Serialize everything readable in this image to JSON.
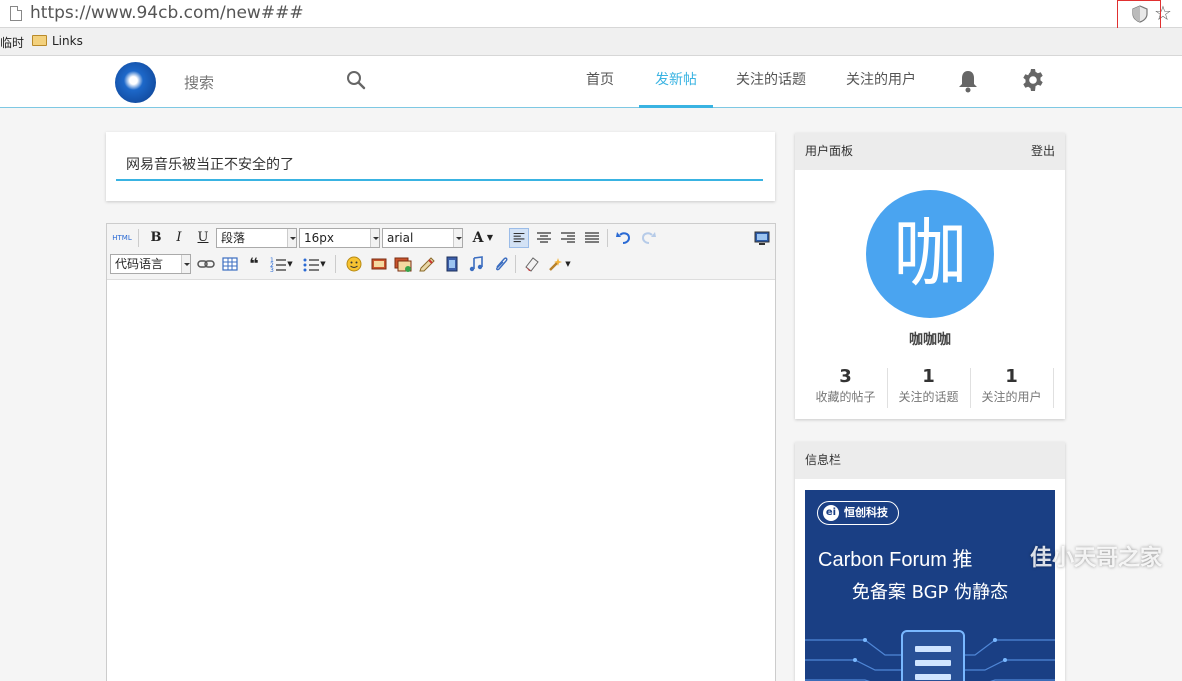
{
  "browser": {
    "url": "https://www.94cb.com/new###",
    "bookmarks": [
      "临时",
      "Links"
    ]
  },
  "nav": {
    "search_placeholder": "搜索",
    "items": [
      "首页",
      "发新帖",
      "关注的话题",
      "关注的用户"
    ],
    "active_item": "发新帖"
  },
  "composer": {
    "title_value": "网易音乐被当正不安全的了",
    "toolbar": {
      "html_label": "HTML",
      "bold": "B",
      "italic": "I",
      "underline": "U",
      "paragraph": "段落",
      "font_size": "16px",
      "font_family": "arial",
      "font_color": "A",
      "code_language": "代码语言"
    }
  },
  "user_panel": {
    "title": "用户面板",
    "logout": "登出",
    "avatar_char": "咖",
    "username": "咖咖咖",
    "stats": [
      {
        "value": "3",
        "label": "收藏的帖子"
      },
      {
        "value": "1",
        "label": "关注的话题"
      },
      {
        "value": "1",
        "label": "关注的用户"
      }
    ]
  },
  "info_panel": {
    "title": "信息栏",
    "ad": {
      "badge": "恒创科技",
      "headline": "Carbon Forum 推",
      "subline": "免备案 BGP 伪静态"
    }
  },
  "watermark": "佳小天哥之家",
  "colors": {
    "accent": "#39b3e2",
    "avatar_bg": "#4aa4f0",
    "ad_bg": "#1a3f84"
  }
}
